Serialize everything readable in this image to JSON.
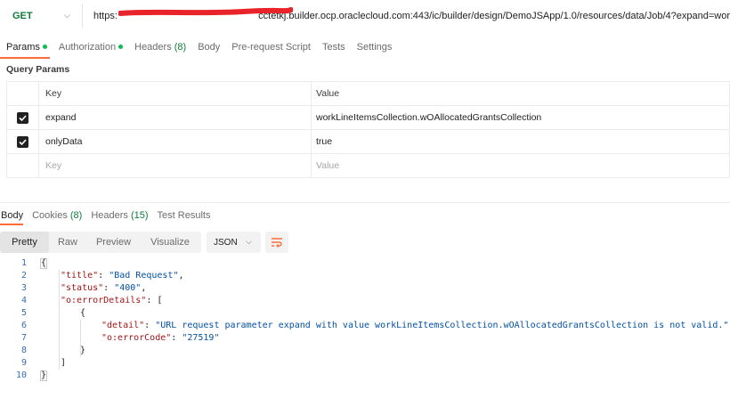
{
  "request": {
    "method": "GET",
    "url_prefix": "https:",
    "url_suffix": "cctetkj.builder.ocp.oraclecloud.com:443/ic/builder/design/DemoJSApp/1.0/resources/data/Job/4?expand=wor"
  },
  "request_tabs": [
    {
      "label": "Params",
      "dot": true
    },
    {
      "label": "Authorization",
      "dot": true
    },
    {
      "label": "Headers",
      "count": "(8)"
    },
    {
      "label": "Body"
    },
    {
      "label": "Pre-request Script"
    },
    {
      "label": "Tests"
    },
    {
      "label": "Settings"
    }
  ],
  "query_params": {
    "title": "Query Params",
    "header": {
      "key": "Key",
      "value": "Value"
    },
    "rows": [
      {
        "key": "expand",
        "value": "workLineItemsCollection.wOAllocatedGrantsCollection",
        "checked": true
      },
      {
        "key": "onlyData",
        "value": "true",
        "checked": true
      }
    ],
    "placeholder": {
      "key": "Key",
      "value": "Value"
    }
  },
  "response_tabs": [
    {
      "label": "Body"
    },
    {
      "label": "Cookies",
      "count": "(8)"
    },
    {
      "label": "Headers",
      "count": "(15)"
    },
    {
      "label": "Test Results"
    }
  ],
  "view_modes": [
    "Pretty",
    "Raw",
    "Preview",
    "Visualize"
  ],
  "format": "JSON",
  "icons": {
    "method_chevron": "chevron-down-icon",
    "format_chevron": "chevron-down-icon",
    "wrap": "wrap-lines-icon",
    "checkbox": "checkbox-checked-icon"
  },
  "colors": {
    "accent": "#ff6c37",
    "method": "#0f7b3d",
    "status_dot": "#0cbb52",
    "json_key": "#a31515",
    "json_string": "#0451a5"
  },
  "response_body": {
    "line_numbers": [
      "1",
      "2",
      "3",
      "4",
      "5",
      "6",
      "7",
      "8",
      "9",
      "10"
    ],
    "title_key": "\"title\"",
    "title_value": "\"Bad Request\"",
    "status_key": "\"status\"",
    "status_value": "\"400\"",
    "error_details_key": "\"o:errorDetails\"",
    "detail_key": "\"detail\"",
    "detail_value": "\"URL request parameter expand with value workLineItemsCollection.wOAllocatedGrantsCollection is not valid.\"",
    "error_code_key": "\"o:errorCode\"",
    "error_code_value": "\"27519\""
  }
}
